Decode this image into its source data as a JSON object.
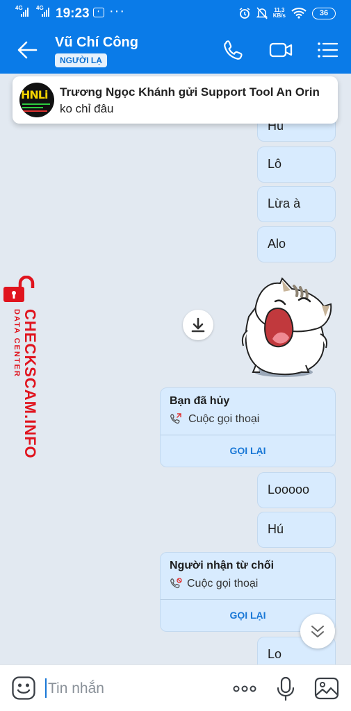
{
  "status_bar": {
    "network1": "4G",
    "network2": "4G",
    "time": "19:23",
    "more": "···",
    "speed_value": "11,3",
    "speed_unit": "KB/s",
    "battery": "36"
  },
  "header": {
    "title": "Vũ Chí Công",
    "badge": "NGƯỜI LẠ"
  },
  "notification": {
    "title": "Trương Ngọc Khánh gửi Support Tool An Orin",
    "body": "ko chỉ đâu"
  },
  "messages": {
    "m0": "Hú",
    "m1": "Lô",
    "m2": "Lừa à",
    "m3": "Alo",
    "m4": "Looooo",
    "m5": "Hú",
    "m6": "Lo"
  },
  "calls": [
    {
      "title": "Bạn đã hủy",
      "subtitle": "Cuộc gọi thoại",
      "action": "GỌI LẠI"
    },
    {
      "title": "Người nhận từ chối",
      "subtitle": "Cuộc gọi thoại",
      "action": "GỌI LẠI"
    }
  ],
  "watermark": {
    "small": "DATA CENTER",
    "big": "CHECKSCAM.INFO"
  },
  "composer": {
    "placeholder": "Tin nhắn"
  },
  "colors": {
    "header": "#0a7be8",
    "bubble": "#d8ebfe",
    "background": "#e2e9f1",
    "accent": "#1877d6",
    "watermark": "#e0141e"
  }
}
